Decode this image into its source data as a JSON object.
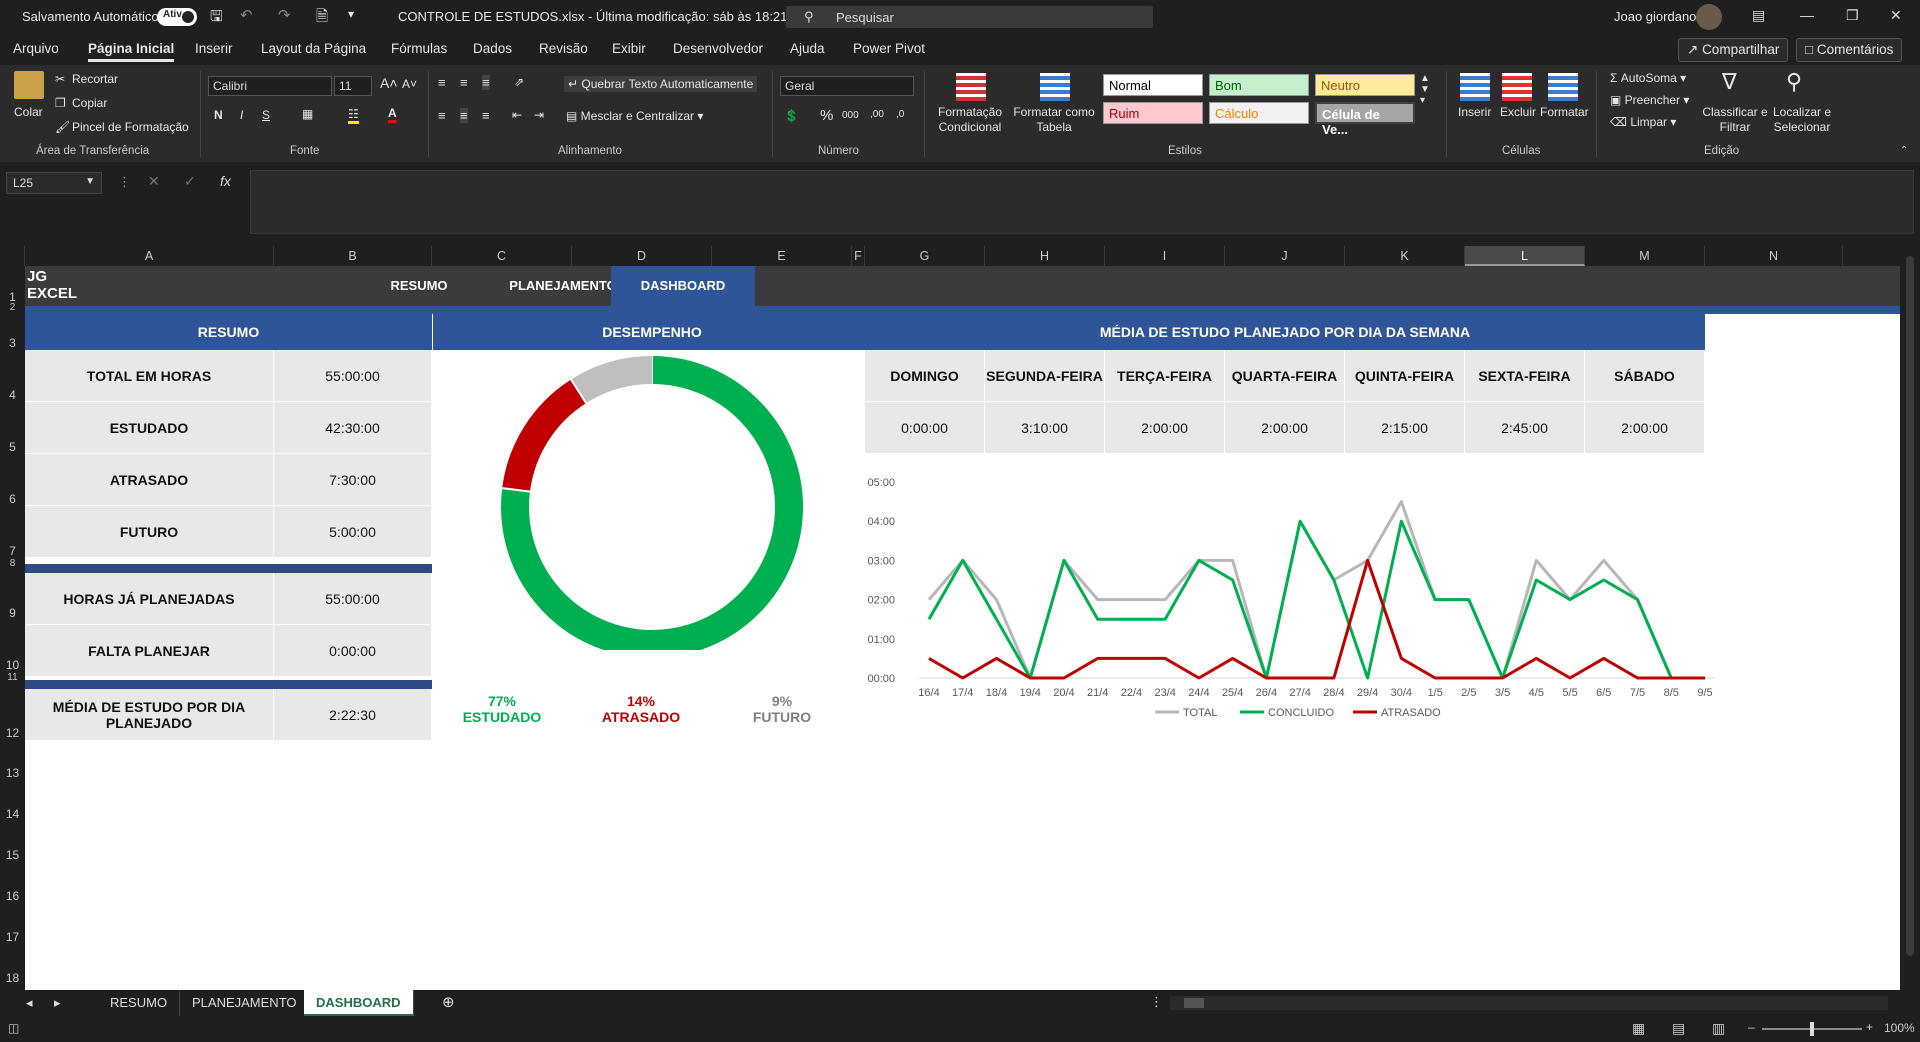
{
  "titlebar": {
    "autosave_label": "Salvamento Automático",
    "autosave_state": "Ativado",
    "file_title": "CONTROLE DE ESTUDOS.xlsx  -  Última modificação: sáb às 18:21",
    "search_placeholder": "Pesquisar",
    "user_name": "Joao giordano"
  },
  "menu": {
    "tabs": [
      "Arquivo",
      "Página Inicial",
      "Inserir",
      "Layout da Página",
      "Fórmulas",
      "Dados",
      "Revisão",
      "Exibir",
      "Desenvolvedor",
      "Ajuda",
      "Power Pivot"
    ],
    "share": "Compartilhar",
    "comments": "Comentários"
  },
  "ribbon": {
    "clipboard": {
      "paste": "Colar",
      "cut": "Recortar",
      "copy": "Copiar",
      "format_painter": "Pincel de Formatação",
      "group": "Área de Transferência"
    },
    "font": {
      "name": "Calibri",
      "size": "11",
      "bold": "N",
      "italic": "I",
      "underline": "S",
      "group": "Fonte"
    },
    "alignment": {
      "wrap": "Quebrar Texto Automaticamente",
      "merge": "Mesclar e Centralizar",
      "group": "Alinhamento"
    },
    "number": {
      "format": "Geral",
      "group": "Número"
    },
    "styles": {
      "cond_format": "Formatação Condicional",
      "format_table": "Formatar como Tabela",
      "normal": "Normal",
      "good": "Bom",
      "neutral": "Neutro",
      "bad": "Ruim",
      "calc": "Cálculo",
      "cell_check": "Célula de Ve...",
      "group": "Estilos"
    },
    "cells": {
      "insert": "Inserir",
      "delete": "Excluir",
      "format": "Formatar",
      "group": "Células"
    },
    "editing": {
      "autosum": "AutoSoma",
      "fill": "Preencher",
      "clear": "Limpar",
      "sort": "Classificar e Filtrar",
      "find": "Localizar e Selecionar",
      "group": "Edição"
    }
  },
  "formula": {
    "name_box": "L25",
    "fx": "fx"
  },
  "columns": [
    "A",
    "B",
    "C",
    "D",
    "E",
    "F",
    "G",
    "H",
    "I",
    "J",
    "K",
    "L",
    "M",
    "N"
  ],
  "rows": [
    "1",
    "2",
    "3",
    "4",
    "5",
    "6",
    "7",
    "8",
    "9",
    "10",
    "11",
    "12",
    "13",
    "14",
    "15",
    "16",
    "17",
    "18"
  ],
  "sheet": {
    "logo": [
      "JG",
      "EXCEL"
    ],
    "nav": [
      "RESUMO",
      "PLANEJAMENTO",
      "DASHBOARD"
    ],
    "resumo": {
      "title": "RESUMO",
      "rows": [
        {
          "label": "TOTAL EM HORAS",
          "value": "55:00:00"
        },
        {
          "label": "ESTUDADO",
          "value": "42:30:00"
        },
        {
          "label": "ATRASADO",
          "value": "7:30:00"
        },
        {
          "label": "FUTURO",
          "value": "5:00:00"
        }
      ],
      "rows2": [
        {
          "label": "HORAS JÁ PLANEJADAS",
          "value": "55:00:00"
        },
        {
          "label": "FALTA PLANEJAR",
          "value": "0:00:00"
        }
      ],
      "media": {
        "label": "MÉDIA DE ESTUDO POR DIA PLANEJADO",
        "value": "2:22:30"
      }
    },
    "desempenho": {
      "title": "DESEMPENHO",
      "segments": [
        {
          "label": "ESTUDADO",
          "pct_text": "77%",
          "value": 77,
          "color": "#00b050"
        },
        {
          "label": "ATRASADO",
          "pct_text": "14%",
          "value": 14,
          "color": "#c00000"
        },
        {
          "label": "FUTURO",
          "pct_text": "9%",
          "value": 9,
          "color": "#bfbfbf"
        }
      ]
    },
    "media_semana": {
      "title": "MÉDIA DE ESTUDO PLANEJADO POR DIA DA SEMANA",
      "days": [
        "DOMINGO",
        "SEGUNDA-FEIRA",
        "TERÇA-FEIRA",
        "QUARTA-FEIRA",
        "QUINTA-FEIRA",
        "SEXTA-FEIRA",
        "SÁBADO"
      ],
      "values": [
        "0:00:00",
        "3:10:00",
        "2:00:00",
        "2:00:00",
        "2:15:00",
        "2:45:00",
        "2:00:00"
      ]
    }
  },
  "chart_data": [
    {
      "type": "pie",
      "categories": [
        "ESTUDADO",
        "ATRASADO",
        "FUTURO"
      ],
      "values": [
        77,
        14,
        9
      ]
    },
    {
      "type": "line",
      "categories": [
        "16/4",
        "17/4",
        "18/4",
        "19/4",
        "20/4",
        "21/4",
        "22/4",
        "23/4",
        "24/4",
        "25/4",
        "26/4",
        "27/4",
        "28/4",
        "29/4",
        "30/4",
        "1/5",
        "2/5",
        "3/5",
        "4/5",
        "5/5",
        "6/5",
        "7/5",
        "8/5",
        "9/5"
      ],
      "yticks": [
        "00:00",
        "01:00",
        "02:00",
        "03:00",
        "04:00",
        "05:00"
      ],
      "ylim": [
        0,
        5
      ],
      "series": [
        {
          "name": "TOTAL",
          "color": "#b7b7b7",
          "values": [
            2,
            3,
            2,
            0,
            3,
            2,
            2,
            2,
            3,
            3,
            0,
            4,
            2.5,
            3,
            4.5,
            2,
            2,
            0,
            3,
            2,
            3,
            2,
            0,
            0
          ]
        },
        {
          "name": "CONCLUIDO",
          "color": "#00b050",
          "values": [
            1.5,
            3,
            1.5,
            0,
            3,
            1.5,
            1.5,
            1.5,
            3,
            2.5,
            0,
            4,
            2.5,
            0,
            4,
            2,
            2,
            0,
            2.5,
            2,
            2.5,
            2,
            0,
            0
          ]
        },
        {
          "name": "ATRASADO",
          "color": "#c00000",
          "values": [
            0.5,
            0,
            0.5,
            0,
            0,
            0.5,
            0.5,
            0.5,
            0,
            0.5,
            0,
            0,
            0,
            3,
            0.5,
            0,
            0,
            0,
            0.5,
            0,
            0.5,
            0,
            0,
            0
          ]
        }
      ],
      "legend_position": "bottom"
    }
  ],
  "sheet_tabs": [
    "RESUMO",
    "PLANEJAMENTO",
    "DASHBOARD"
  ],
  "status": {
    "zoom": "100%"
  }
}
